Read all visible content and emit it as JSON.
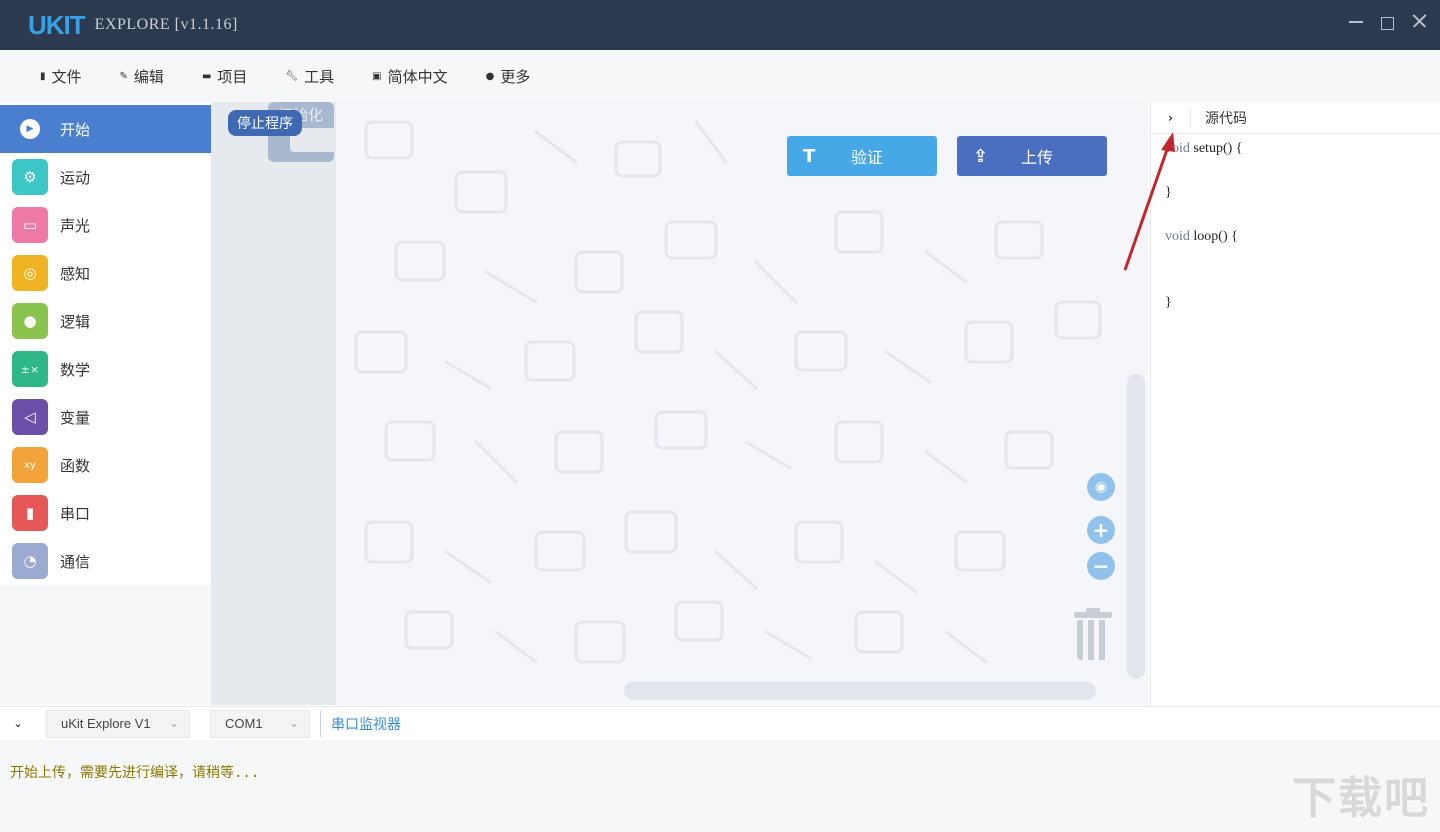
{
  "window": {
    "logo": "UKIT",
    "title": "EXPLORE [v1.1.16]"
  },
  "menu": [
    {
      "icon": "file-icon",
      "label": "文件"
    },
    {
      "icon": "edit-icon",
      "label": "编辑"
    },
    {
      "icon": "folder-icon",
      "label": "项目"
    },
    {
      "icon": "wrench-icon",
      "label": "工具"
    },
    {
      "icon": "language-icon",
      "label": "简体中文"
    },
    {
      "icon": "help-icon",
      "label": "更多"
    }
  ],
  "sidebar": {
    "items": [
      {
        "label": "开始",
        "color": "#4a7fd0",
        "active": true
      },
      {
        "label": "运动",
        "color": "#3cc6c6"
      },
      {
        "label": "声光",
        "color": "#ef7aa8"
      },
      {
        "label": "感知",
        "color": "#f0b323"
      },
      {
        "label": "逻辑",
        "color": "#8ac44f"
      },
      {
        "label": "数学",
        "color": "#2eb888"
      },
      {
        "label": "变量",
        "color": "#6b4fa8"
      },
      {
        "label": "函数",
        "color": "#f2a43a"
      },
      {
        "label": "串口",
        "color": "#e65757"
      },
      {
        "label": "通信",
        "color": "#9aaad0"
      }
    ]
  },
  "flyout": {
    "init_label": "初始化",
    "stop_label": "停止程序"
  },
  "workspace": {
    "verify_label": "验证",
    "upload_label": "上传"
  },
  "code_panel": {
    "toggle": "›",
    "title": "源代码",
    "lines": [
      "void setup() {",
      "",
      "}",
      "",
      "void loop() {",
      "",
      "",
      "}"
    ]
  },
  "bottom": {
    "collapse": "⌄",
    "board": "uKit Explore V1",
    "port": "COM1",
    "serial_monitor": "串口监视器"
  },
  "console": {
    "message": "开始上传，需要先进行编译，请稍等..."
  },
  "watermark": "下载吧"
}
